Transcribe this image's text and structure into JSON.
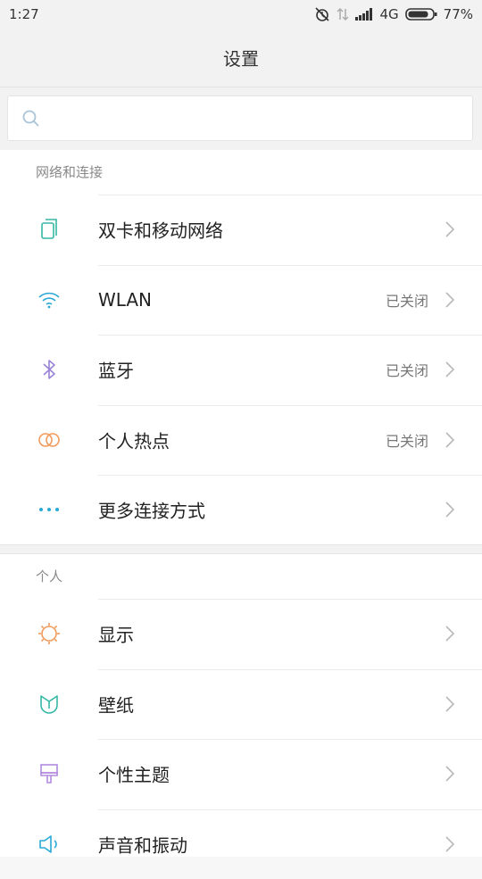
{
  "status_bar": {
    "time": "1:27",
    "network": "4G",
    "battery": "77%",
    "icons": [
      "alarm-off-icon",
      "data-arrows-icon",
      "signal-icon",
      "battery-icon"
    ]
  },
  "title": "设置",
  "search": {
    "placeholder": ""
  },
  "sections": [
    {
      "header": "网络和连接",
      "items": [
        {
          "label": "双卡和移动网络",
          "value": "",
          "icon": "sim-card-icon",
          "color": "#35b7a5"
        },
        {
          "label": "WLAN",
          "value": "已关闭",
          "icon": "wifi-icon",
          "color": "#29a9d6"
        },
        {
          "label": "蓝牙",
          "value": "已关闭",
          "icon": "bluetooth-icon",
          "color": "#9a84d8"
        },
        {
          "label": "个人热点",
          "value": "已关闭",
          "icon": "hotspot-icon",
          "color": "#f19a5b"
        },
        {
          "label": "更多连接方式",
          "value": "",
          "icon": "more-dots-icon",
          "color": "#29a9d6"
        }
      ]
    },
    {
      "header": "个人",
      "items": [
        {
          "label": "显示",
          "value": "",
          "icon": "brightness-icon",
          "color": "#f19a5b"
        },
        {
          "label": "壁纸",
          "value": "",
          "icon": "wallpaper-icon",
          "color": "#35b7a5"
        },
        {
          "label": "个性主题",
          "value": "",
          "icon": "theme-brush-icon",
          "color": "#b38be0"
        },
        {
          "label": "声音和振动",
          "value": "",
          "icon": "sound-icon",
          "color": "#29a9d6"
        }
      ]
    }
  ]
}
